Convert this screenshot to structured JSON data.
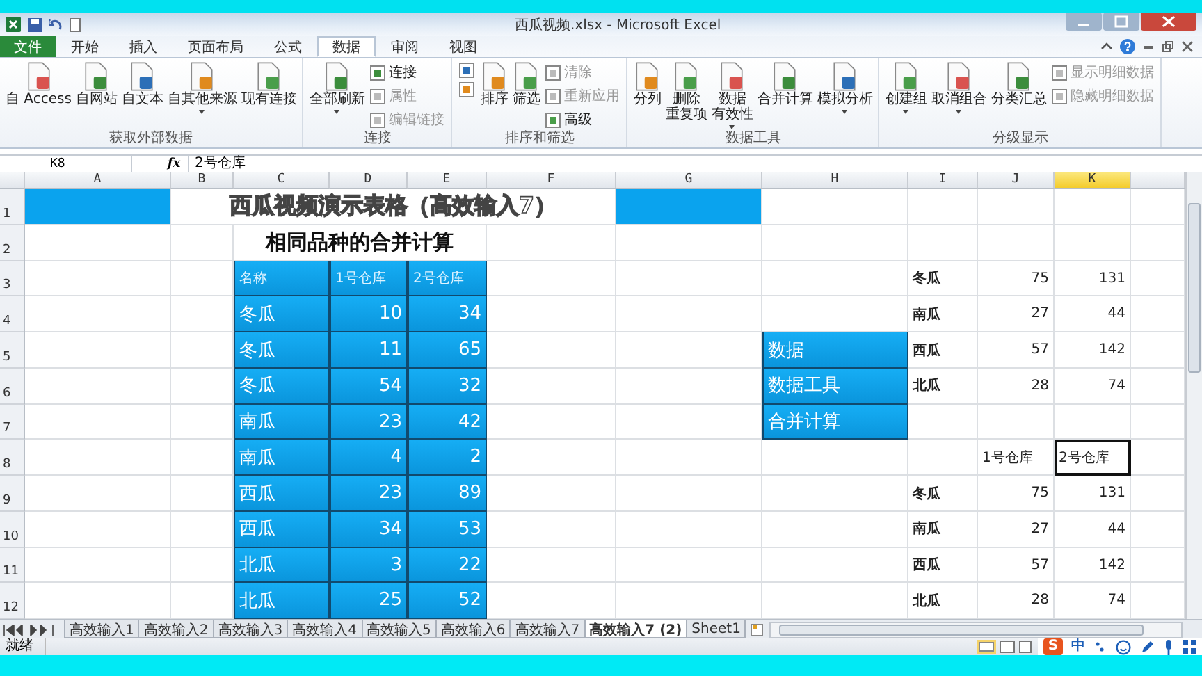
{
  "window": {
    "title": "西瓜视频.xlsx - Microsoft Excel"
  },
  "ribbon_tabs": [
    {
      "label": "文件",
      "selected": false,
      "kind": "file"
    },
    {
      "label": "开始",
      "selected": false,
      "kind": "tab"
    },
    {
      "label": "插入",
      "selected": false,
      "kind": "tab"
    },
    {
      "label": "页面布局",
      "selected": false,
      "kind": "tab"
    },
    {
      "label": "公式",
      "selected": false,
      "kind": "tab"
    },
    {
      "label": "数据",
      "selected": true,
      "kind": "tab"
    },
    {
      "label": "审阅",
      "selected": false,
      "kind": "tab"
    },
    {
      "label": "视图",
      "selected": false,
      "kind": "tab"
    }
  ],
  "ribbon_groups": [
    {
      "label": "获取外部数据",
      "controls": [
        {
          "kind": "large",
          "lines": [
            "自 Access"
          ],
          "dropdown": false
        },
        {
          "kind": "large",
          "lines": [
            "自网站"
          ],
          "dropdown": false
        },
        {
          "kind": "large",
          "lines": [
            "自文本"
          ],
          "dropdown": false
        },
        {
          "kind": "large",
          "lines": [
            "自其他来源"
          ],
          "dropdown": true
        },
        {
          "kind": "large",
          "lines": [
            "现有连接"
          ],
          "dropdown": false
        }
      ]
    },
    {
      "label": "连接",
      "controls": [
        {
          "kind": "large",
          "lines": [
            "全部刷新"
          ],
          "dropdown": true
        },
        {
          "kind": "stack",
          "items": [
            {
              "label": "连接",
              "disabled": false
            },
            {
              "label": "属性",
              "disabled": true
            },
            {
              "label": "编辑链接",
              "disabled": true
            }
          ]
        }
      ]
    },
    {
      "label": "排序和筛选",
      "controls": [
        {
          "kind": "stack",
          "items": [
            {
              "disabled": false
            },
            {
              "disabled": false
            }
          ]
        },
        {
          "kind": "large",
          "lines": [
            "排序"
          ],
          "dropdown": false
        },
        {
          "kind": "large",
          "lines": [
            "筛选"
          ],
          "dropdown": false
        },
        {
          "kind": "stack",
          "items": [
            {
              "label": "清除",
              "disabled": true
            },
            {
              "label": "重新应用",
              "disabled": true
            },
            {
              "label": "高级",
              "disabled": false
            }
          ]
        }
      ]
    },
    {
      "label": "数据工具",
      "controls": [
        {
          "kind": "large",
          "lines": [
            "分列"
          ],
          "dropdown": false
        },
        {
          "kind": "large",
          "lines": [
            "删除",
            "重复项"
          ],
          "dropdown": false
        },
        {
          "kind": "large",
          "lines": [
            "数据",
            "有效性"
          ],
          "dropdown": true
        },
        {
          "kind": "large",
          "lines": [
            "合并计算"
          ],
          "dropdown": false
        },
        {
          "kind": "large",
          "lines": [
            "模拟分析"
          ],
          "dropdown": true
        }
      ]
    },
    {
      "label": "分级显示",
      "controls": [
        {
          "kind": "large",
          "lines": [
            "创建组"
          ],
          "dropdown": true
        },
        {
          "kind": "large",
          "lines": [
            "取消组合"
          ],
          "dropdown": true
        },
        {
          "kind": "large",
          "lines": [
            "分类汇总"
          ],
          "dropdown": false
        },
        {
          "kind": "stack",
          "items": [
            {
              "label": "显示明细数据",
              "disabled": true
            },
            {
              "label": "隐藏明细数据",
              "disabled": true
            }
          ]
        }
      ]
    }
  ],
  "formula_bar": {
    "name_box": "K8",
    "function_label": "fx",
    "value": "2号仓库"
  },
  "columns": [
    {
      "label": "A",
      "selected": false
    },
    {
      "label": "B",
      "selected": false
    },
    {
      "label": "C",
      "selected": false
    },
    {
      "label": "D",
      "selected": false
    },
    {
      "label": "E",
      "selected": false
    },
    {
      "label": "F",
      "selected": false
    },
    {
      "label": "G",
      "selected": false
    },
    {
      "label": "H",
      "selected": false
    },
    {
      "label": "I",
      "selected": false
    },
    {
      "label": "J",
      "selected": false
    },
    {
      "label": "K",
      "selected": true
    }
  ],
  "rows": [
    {
      "number": "1",
      "cells": [
        {
          "kind": "fill"
        },
        {
          "kind": "title",
          "text": "西瓜视频演示表格（高效输入7）"
        },
        {
          "kind": "fill"
        },
        {
          "kind": "empty"
        },
        {
          "kind": "empty"
        },
        {
          "kind": "empty"
        },
        {
          "kind": "empty"
        }
      ]
    },
    {
      "number": "2",
      "cells": [
        {
          "kind": "empty"
        },
        {
          "kind": "empty"
        },
        {
          "kind": "heading",
          "text": "相同品种的合并计算"
        },
        {
          "kind": "empty"
        },
        {
          "kind": "empty"
        },
        {
          "kind": "empty"
        },
        {
          "kind": "empty"
        },
        {
          "kind": "empty"
        },
        {
          "kind": "empty"
        }
      ]
    },
    {
      "number": "3",
      "cells": [
        {
          "kind": "empty"
        },
        {
          "kind": "empty"
        },
        {
          "kind": "table_header",
          "text": "名称"
        },
        {
          "kind": "table_header",
          "text": "1号仓库"
        },
        {
          "kind": "table_header",
          "text": "2号仓库"
        },
        {
          "kind": "empty"
        },
        {
          "kind": "empty"
        },
        {
          "kind": "empty"
        },
        {
          "kind": "name",
          "text": "冬瓜"
        },
        {
          "kind": "number",
          "text": "75"
        },
        {
          "kind": "number",
          "text": "131"
        }
      ]
    },
    {
      "number": "4",
      "cells": [
        {
          "kind": "empty"
        },
        {
          "kind": "empty"
        },
        {
          "kind": "table_name",
          "text": "冬瓜"
        },
        {
          "kind": "table_number",
          "text": "10"
        },
        {
          "kind": "table_number",
          "text": "34"
        },
        {
          "kind": "empty"
        },
        {
          "kind": "empty"
        },
        {
          "kind": "empty"
        },
        {
          "kind": "name",
          "text": "南瓜"
        },
        {
          "kind": "number",
          "text": "27"
        },
        {
          "kind": "number",
          "text": "44"
        }
      ]
    },
    {
      "number": "5",
      "cells": [
        {
          "kind": "empty"
        },
        {
          "kind": "empty"
        },
        {
          "kind": "table_name",
          "text": "冬瓜"
        },
        {
          "kind": "table_number",
          "text": "11"
        },
        {
          "kind": "table_number",
          "text": "65"
        },
        {
          "kind": "empty"
        },
        {
          "kind": "empty"
        },
        {
          "kind": "blue_label",
          "text": "数据"
        },
        {
          "kind": "name",
          "text": "西瓜"
        },
        {
          "kind": "number",
          "text": "57"
        },
        {
          "kind": "number",
          "text": "142"
        }
      ]
    },
    {
      "number": "6",
      "cells": [
        {
          "kind": "empty"
        },
        {
          "kind": "empty"
        },
        {
          "kind": "table_name",
          "text": "冬瓜"
        },
        {
          "kind": "table_number",
          "text": "54"
        },
        {
          "kind": "table_number",
          "text": "32"
        },
        {
          "kind": "empty"
        },
        {
          "kind": "empty"
        },
        {
          "kind": "blue_label",
          "text": "数据工具"
        },
        {
          "kind": "name",
          "text": "北瓜"
        },
        {
          "kind": "number",
          "text": "28"
        },
        {
          "kind": "number",
          "text": "74"
        }
      ]
    },
    {
      "number": "7",
      "cells": [
        {
          "kind": "empty"
        },
        {
          "kind": "empty"
        },
        {
          "kind": "table_name",
          "text": "南瓜"
        },
        {
          "kind": "table_number",
          "text": "23"
        },
        {
          "kind": "table_number",
          "text": "42"
        },
        {
          "kind": "empty"
        },
        {
          "kind": "empty"
        },
        {
          "kind": "blue_label",
          "text": "合并计算"
        },
        {
          "kind": "empty"
        },
        {
          "kind": "empty"
        },
        {
          "kind": "empty"
        }
      ]
    },
    {
      "number": "8",
      "cells": [
        {
          "kind": "empty"
        },
        {
          "kind": "empty"
        },
        {
          "kind": "table_name",
          "text": "南瓜"
        },
        {
          "kind": "table_number",
          "text": "4"
        },
        {
          "kind": "table_number",
          "text": "2"
        },
        {
          "kind": "empty"
        },
        {
          "kind": "empty"
        },
        {
          "kind": "empty"
        },
        {
          "kind": "empty"
        },
        {
          "kind": "text",
          "text": "1号仓库",
          "selected": false
        },
        {
          "kind": "text",
          "text": "2号仓库",
          "selected": true
        }
      ]
    },
    {
      "number": "9",
      "cells": [
        {
          "kind": "empty"
        },
        {
          "kind": "empty"
        },
        {
          "kind": "table_name",
          "text": "西瓜"
        },
        {
          "kind": "table_number",
          "text": "23"
        },
        {
          "kind": "table_number",
          "text": "89"
        },
        {
          "kind": "empty"
        },
        {
          "kind": "empty"
        },
        {
          "kind": "empty"
        },
        {
          "kind": "name",
          "text": "冬瓜"
        },
        {
          "kind": "number",
          "text": "75"
        },
        {
          "kind": "number",
          "text": "131"
        }
      ]
    },
    {
      "number": "10",
      "cells": [
        {
          "kind": "empty"
        },
        {
          "kind": "empty"
        },
        {
          "kind": "table_name",
          "text": "西瓜"
        },
        {
          "kind": "table_number",
          "text": "34"
        },
        {
          "kind": "table_number",
          "text": "53"
        },
        {
          "kind": "empty"
        },
        {
          "kind": "empty"
        },
        {
          "kind": "empty"
        },
        {
          "kind": "name",
          "text": "南瓜"
        },
        {
          "kind": "number",
          "text": "27"
        },
        {
          "kind": "number",
          "text": "44"
        }
      ]
    },
    {
      "number": "11",
      "cells": [
        {
          "kind": "empty"
        },
        {
          "kind": "empty"
        },
        {
          "kind": "table_name",
          "text": "北瓜"
        },
        {
          "kind": "table_number",
          "text": "3"
        },
        {
          "kind": "table_number",
          "text": "22"
        },
        {
          "kind": "empty"
        },
        {
          "kind": "empty"
        },
        {
          "kind": "empty"
        },
        {
          "kind": "name",
          "text": "西瓜"
        },
        {
          "kind": "number",
          "text": "57"
        },
        {
          "kind": "number",
          "text": "142"
        }
      ]
    },
    {
      "number": "12",
      "cells": [
        {
          "kind": "empty"
        },
        {
          "kind": "empty"
        },
        {
          "kind": "table_name",
          "text": "北瓜"
        },
        {
          "kind": "table_number",
          "text": "25"
        },
        {
          "kind": "table_number",
          "text": "52"
        },
        {
          "kind": "empty"
        },
        {
          "kind": "empty"
        },
        {
          "kind": "empty"
        },
        {
          "kind": "name",
          "text": "北瓜"
        },
        {
          "kind": "number",
          "text": "28"
        },
        {
          "kind": "number",
          "text": "74"
        }
      ]
    }
  ],
  "sheet_tabs": [
    {
      "label": "高效输入1",
      "selected": false
    },
    {
      "label": "高效输入2",
      "selected": false
    },
    {
      "label": "高效输入3",
      "selected": false
    },
    {
      "label": "高效输入4",
      "selected": false
    },
    {
      "label": "高效输入5",
      "selected": false
    },
    {
      "label": "高效输入6",
      "selected": false
    },
    {
      "label": "高效输入7",
      "selected": false
    },
    {
      "label": "高效输入7 (2)",
      "selected": true
    },
    {
      "label": "Sheet1",
      "selected": false
    }
  ],
  "status_bar": {
    "text": "就绪",
    "ime_logo": "S",
    "ime_mode": "中"
  }
}
